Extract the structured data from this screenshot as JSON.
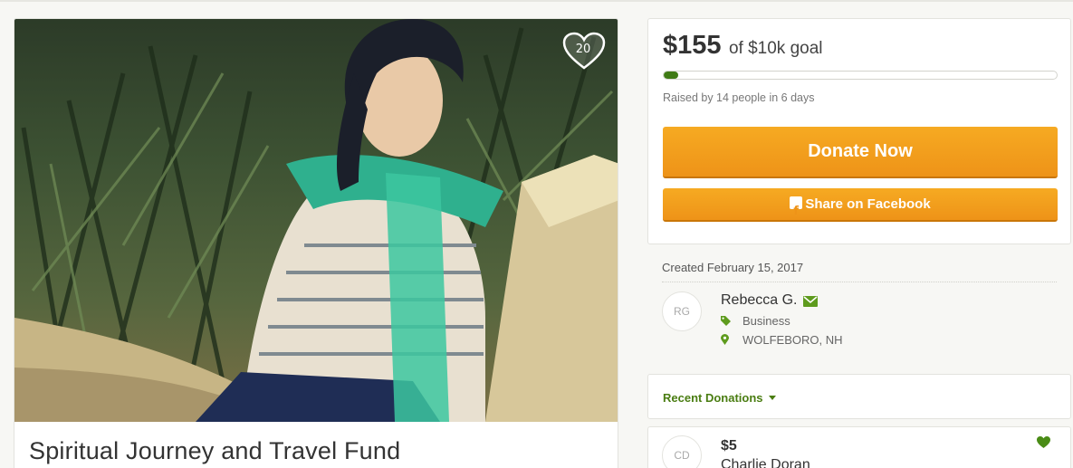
{
  "campaign": {
    "title": "Spiritual Journey and Travel Fund",
    "hearts_count": "20",
    "photo_icon": "campaign-photo"
  },
  "funding": {
    "raised_amount": "$155",
    "goal_text": "of $10k goal",
    "progress_fraction": 0.0155,
    "raised_summary": "Raised by 14 people in 6 days",
    "donate_label": "Donate Now",
    "share_label": "Share on Facebook",
    "share_icon": "facebook-icon"
  },
  "organizer": {
    "created": "Created February 15, 2017",
    "initials": "RG",
    "name": "Rebecca G.",
    "category": "Business",
    "location": "WOLFEBORO, NH",
    "contact_icon": "envelope-icon"
  },
  "recent_donations": {
    "label": "Recent Donations",
    "items": [
      {
        "initials": "CD",
        "amount": "$5",
        "name": "Charlie Doran"
      }
    ]
  },
  "colors": {
    "accent_green": "#4a7d12",
    "progress_green": "#3f7a15",
    "button_orange": "#f19a1c"
  }
}
